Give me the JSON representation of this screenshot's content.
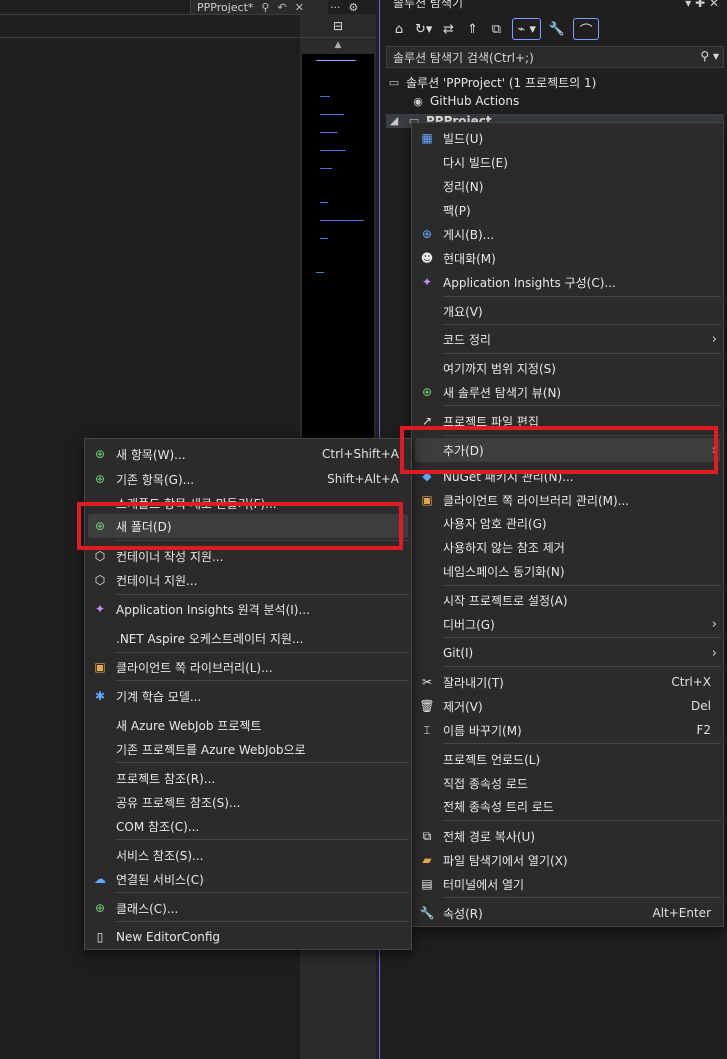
{
  "editor": {
    "tab_title": "PPProject*",
    "tab_icons": [
      "pin-icon",
      "back-icon",
      "close-icon"
    ],
    "overflow_label": "···"
  },
  "solution_explorer": {
    "title": "솔루션 탐색기",
    "search_placeholder": "솔루션 탐색기 검색(Ctrl+;)",
    "tree": {
      "solution": "솔루션 'PPProject' (1 프로젝트의 1)",
      "github": "GitHub Actions",
      "project": "PPProject"
    }
  },
  "context_menu": {
    "items": [
      {
        "icon": "build-icon",
        "label": "빌드(U)",
        "shortcut": ""
      },
      {
        "icon": "",
        "label": "다시 빌드(E)",
        "shortcut": ""
      },
      {
        "icon": "",
        "label": "정리(N)",
        "shortcut": ""
      },
      {
        "icon": "",
        "label": "팩(P)",
        "shortcut": ""
      },
      {
        "icon": "globe-icon",
        "label": "게시(B)...",
        "shortcut": ""
      },
      {
        "icon": "copilot-icon",
        "label": "현대화(M)",
        "shortcut": ""
      },
      {
        "icon": "insights-icon",
        "label": "Application Insights 구성(C)...",
        "shortcut": ""
      },
      {
        "icon": "",
        "label": "개요(V)",
        "shortcut": ""
      },
      {
        "icon": "",
        "label": "코드 정리",
        "shortcut": "",
        "submenu": true
      },
      {
        "icon": "",
        "label": "여기까지 범위 지정(S)",
        "shortcut": ""
      },
      {
        "icon": "new-view-icon",
        "label": "새 솔루션 탐색기 뷰(N)",
        "shortcut": ""
      },
      {
        "icon": "edit-file-icon",
        "label": "프로젝트 파일 편집",
        "shortcut": ""
      },
      {
        "icon": "",
        "label": "추가(D)",
        "shortcut": "",
        "submenu": true
      },
      {
        "icon": "nuget-icon",
        "label": "NuGet 패키지 관리(N)...",
        "shortcut": ""
      },
      {
        "icon": "library-icon",
        "label": "클라이언트 쪽 라이브러리 관리(M)...",
        "shortcut": ""
      },
      {
        "icon": "",
        "label": "사용자 암호 관리(G)",
        "shortcut": ""
      },
      {
        "icon": "",
        "label": "사용하지 않는 참조 제거",
        "shortcut": ""
      },
      {
        "icon": "",
        "label": "네임스페이스 동기화(N)",
        "shortcut": ""
      },
      {
        "icon": "",
        "label": "시작 프로젝트로 설정(A)",
        "shortcut": ""
      },
      {
        "icon": "",
        "label": "디버그(G)",
        "shortcut": "",
        "submenu": true
      },
      {
        "icon": "",
        "label": "Git(I)",
        "shortcut": "",
        "submenu": true
      },
      {
        "icon": "cut-icon",
        "label": "잘라내기(T)",
        "shortcut": "Ctrl+X"
      },
      {
        "icon": "delete-icon",
        "label": "제거(V)",
        "shortcut": "Del"
      },
      {
        "icon": "rename-icon",
        "label": "이름 바꾸기(M)",
        "shortcut": "F2"
      },
      {
        "icon": "",
        "label": "프로젝트 언로드(L)",
        "shortcut": ""
      },
      {
        "icon": "",
        "label": "직접 종속성 로드",
        "shortcut": ""
      },
      {
        "icon": "",
        "label": "전체 종속성 트리 로드",
        "shortcut": ""
      },
      {
        "icon": "copy-icon",
        "label": "전체 경로 복사(U)",
        "shortcut": ""
      },
      {
        "icon": "folder-open-icon",
        "label": "파일 탐색기에서 열기(X)",
        "shortcut": ""
      },
      {
        "icon": "terminal-icon",
        "label": "터미널에서 열기",
        "shortcut": ""
      },
      {
        "icon": "wrench-icon",
        "label": "속성(R)",
        "shortcut": "Alt+Enter"
      }
    ]
  },
  "add_submenu": {
    "items": [
      {
        "icon": "new-item-icon",
        "label": "새 항목(W)...",
        "shortcut": "Ctrl+Shift+A"
      },
      {
        "icon": "existing-item-icon",
        "label": "기존 항목(G)...",
        "shortcut": "Shift+Alt+A"
      },
      {
        "icon": "",
        "label": "스캐폴드 항목 새로 만들기(F)...",
        "shortcut": ""
      },
      {
        "icon": "new-folder-icon",
        "label": "새 폴더(D)",
        "shortcut": ""
      },
      {
        "icon": "container-icon",
        "label": "컨테이너 작성 지원...",
        "shortcut": ""
      },
      {
        "icon": "container-icon",
        "label": "컨테이너 지원...",
        "shortcut": ""
      },
      {
        "icon": "insights-icon",
        "label": "Application Insights 원격 분석(I)...",
        "shortcut": ""
      },
      {
        "icon": "",
        "label": ".NET Aspire 오케스트레이터 지원...",
        "shortcut": ""
      },
      {
        "icon": "library-icon",
        "label": "클라이언트 쪽 라이브러리(L)...",
        "shortcut": ""
      },
      {
        "icon": "ml-icon",
        "label": "기계 학습 모델...",
        "shortcut": ""
      },
      {
        "icon": "",
        "label": "새 Azure WebJob 프로젝트",
        "shortcut": ""
      },
      {
        "icon": "",
        "label": "기존 프로젝트를 Azure WebJob으로",
        "shortcut": ""
      },
      {
        "icon": "",
        "label": "프로젝트 참조(R)...",
        "shortcut": ""
      },
      {
        "icon": "",
        "label": "공유 프로젝트 참조(S)...",
        "shortcut": ""
      },
      {
        "icon": "",
        "label": "COM 참조(C)...",
        "shortcut": ""
      },
      {
        "icon": "",
        "label": "서비스 참조(S)...",
        "shortcut": ""
      },
      {
        "icon": "connected-service-icon",
        "label": "연결된 서비스(C)",
        "shortcut": ""
      },
      {
        "icon": "class-icon",
        "label": "클래스(C)...",
        "shortcut": ""
      },
      {
        "icon": "file-icon",
        "label": "New EditorConfig",
        "shortcut": ""
      }
    ]
  }
}
